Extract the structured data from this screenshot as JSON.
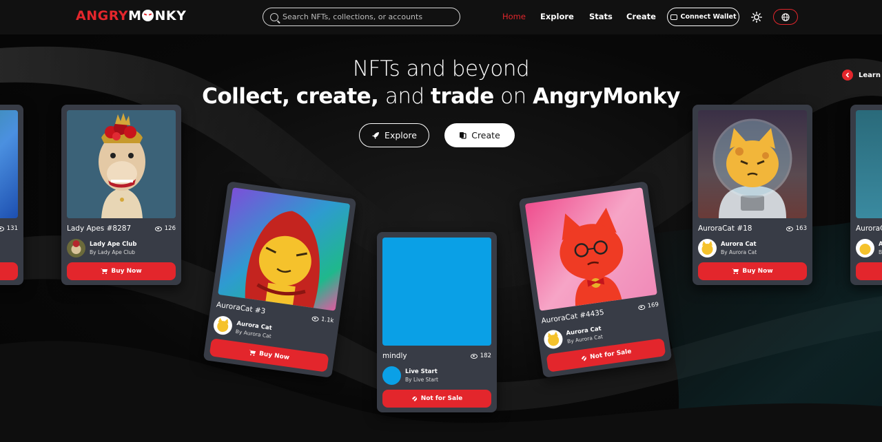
{
  "nav": {
    "logo_part1": "ANGRY",
    "logo_part2": "M",
    "logo_part3": "NKY",
    "search_placeholder": "Search NFTs, collections, or accounts",
    "links": [
      "Home",
      "Explore",
      "Stats",
      "Create"
    ],
    "active_link": "Home",
    "wallet_label": "Connect Wallet",
    "theme_icon": "sun-icon",
    "language_icon": "globe-icon"
  },
  "hero": {
    "title_line1": "NFTs and beyond",
    "title_collect": "Collect,",
    "title_create": "create,",
    "title_and": "and",
    "title_trade": "trade",
    "title_on": "on",
    "title_brand": "AngryMonky",
    "explore_label": "Explore",
    "create_label": "Create",
    "learn_label": "Learn"
  },
  "cards": [
    {
      "name": "",
      "views": "131",
      "collection": "",
      "by": "",
      "action": "",
      "accent": "#2f6ecb"
    },
    {
      "name": "Lady Apes #8287",
      "views": "126",
      "collection": "Lady Ape Club",
      "by": "By Lady Ape Club",
      "action": "Buy Now"
    },
    {
      "name": "AuroraCat #3",
      "views": "1.1k",
      "collection": "Aurora Cat",
      "by": "By Aurora Cat",
      "action": "Buy Now"
    },
    {
      "name": "mindly",
      "views": "182",
      "collection": "Live Start",
      "by": "By Live Start",
      "action": "Not for Sale",
      "art_color": "#0aa0e6"
    },
    {
      "name": "AuroraCat #4435",
      "views": "169",
      "collection": "Aurora Cat",
      "by": "By Aurora Cat",
      "action": "Not for Sale"
    },
    {
      "name": "AuroraCat #18",
      "views": "163",
      "collection": "Aurora Cat",
      "by": "By Aurora Cat",
      "action": "Buy Now"
    },
    {
      "name": "AuroraC",
      "views": "",
      "collection": "A",
      "by": "B",
      "action": ""
    }
  ],
  "colors": {
    "accent": "#e3262c",
    "card_bg": "#383c46",
    "nav_bg": "#111111"
  }
}
